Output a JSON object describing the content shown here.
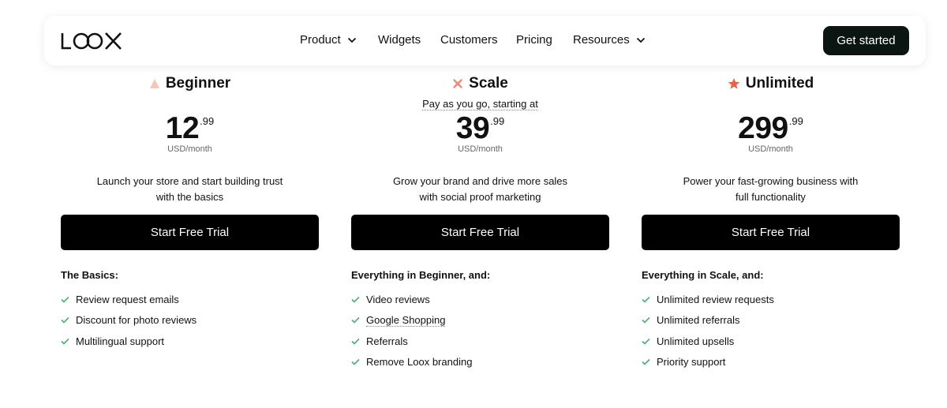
{
  "nav": {
    "logo_text": "LOOX",
    "items": [
      {
        "label": "Product",
        "dropdown": true
      },
      {
        "label": "Widgets",
        "dropdown": false
      },
      {
        "label": "Customers",
        "dropdown": false
      },
      {
        "label": "Pricing",
        "dropdown": false
      },
      {
        "label": "Resources",
        "dropdown": true
      }
    ],
    "cta_label": "Get started"
  },
  "plans": [
    {
      "name": "Beginner",
      "icon": "triangle-icon",
      "icon_color": "#f6c6ba",
      "subtitle": "",
      "price_main": "12",
      "price_cents": ".99",
      "price_unit": "USD/month",
      "desc_line1": "Launch your store and start building trust",
      "desc_line2": "with the basics",
      "button_label": "Start Free Trial",
      "features_title": "The Basics:",
      "features": [
        "Review request emails",
        "Discount for photo reviews",
        "Multilingual support"
      ]
    },
    {
      "name": "Scale",
      "icon": "x-star-icon",
      "icon_color": "#ee8c7c",
      "subtitle": "Pay as you go, starting at",
      "price_main": "39",
      "price_cents": ".99",
      "price_unit": "USD/month",
      "desc_line1": "Grow your brand and drive more sales",
      "desc_line2": "with social proof marketing",
      "button_label": "Start Free Trial",
      "features_title": "Everything in Beginner, and:",
      "features": [
        "Video reviews",
        "Google Shopping",
        "Referrals",
        "Remove Loox branding"
      ]
    },
    {
      "name": "Unlimited",
      "icon": "star-icon",
      "icon_color": "#e8614a",
      "subtitle": "",
      "price_main": "299",
      "price_cents": ".99",
      "price_unit": "USD/month",
      "desc_line1": "Power your fast-growing business with",
      "desc_line2": "full functionality",
      "button_label": "Start Free Trial",
      "features_title": "Everything in Scale, and:",
      "features": [
        "Unlimited review requests",
        "Unlimited referrals",
        "Unlimited upsells",
        "Priority support"
      ]
    }
  ],
  "colors": {
    "check": "#4caf6e",
    "cta_bg": "#0b1512",
    "button_bg": "#000000"
  }
}
